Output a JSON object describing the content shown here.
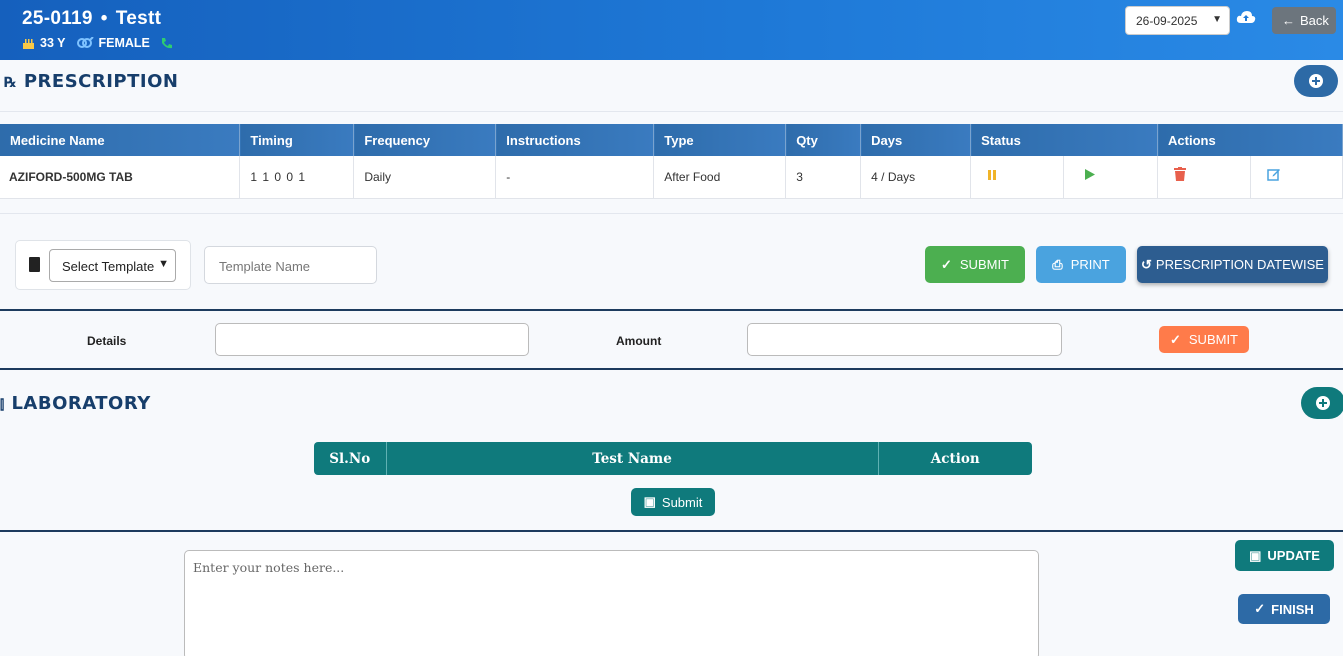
{
  "header": {
    "patient_id": "25-0119",
    "separator": "•",
    "patient_name": "Testt",
    "age": "33 Y",
    "gender": "FEMALE",
    "date_value": "26-09-2025",
    "back_label": "Back",
    "icons": [
      "cake-icon",
      "gender-icon",
      "phone-icon",
      "cloud-upload-icon",
      "arrow-left-icon"
    ]
  },
  "prescription": {
    "title": "PRESCRIPTION",
    "columns": [
      "Medicine Name",
      "Timing",
      "Frequency",
      "Instructions",
      "Type",
      "Qty",
      "Days",
      "Status",
      "Actions"
    ],
    "rows": [
      {
        "medicine": "AZIFORD-500MG TAB",
        "timing": "1 1 0 0 1",
        "frequency": "Daily",
        "instructions": "-",
        "type": "After Food",
        "qty": "3",
        "days": "4 / Days"
      }
    ],
    "template_select": "Select Template",
    "template_name_placeholder": "Template Name",
    "submit_label": "SUBMIT",
    "print_label": "PRINT",
    "datewise_label": "PRESCRIPTION DATEWISE"
  },
  "billing": {
    "details_label": "Details",
    "amount_label": "Amount",
    "submit_label": "SUBMIT"
  },
  "laboratory": {
    "title": "LABORATORY",
    "columns": [
      "Sl.No",
      "Test Name",
      "Action"
    ],
    "submit_label": "Submit"
  },
  "notes": {
    "placeholder": "Enter your notes here...",
    "update_label": "UPDATE",
    "finish_label": "FINISH"
  },
  "colors": {
    "header_blue": "#1f7ad8",
    "table_header_blue": "#2e6cab",
    "teal": "#0f7a7c",
    "green": "#4caf50",
    "orange": "#ff7b4a",
    "navy": "#173e6b"
  }
}
